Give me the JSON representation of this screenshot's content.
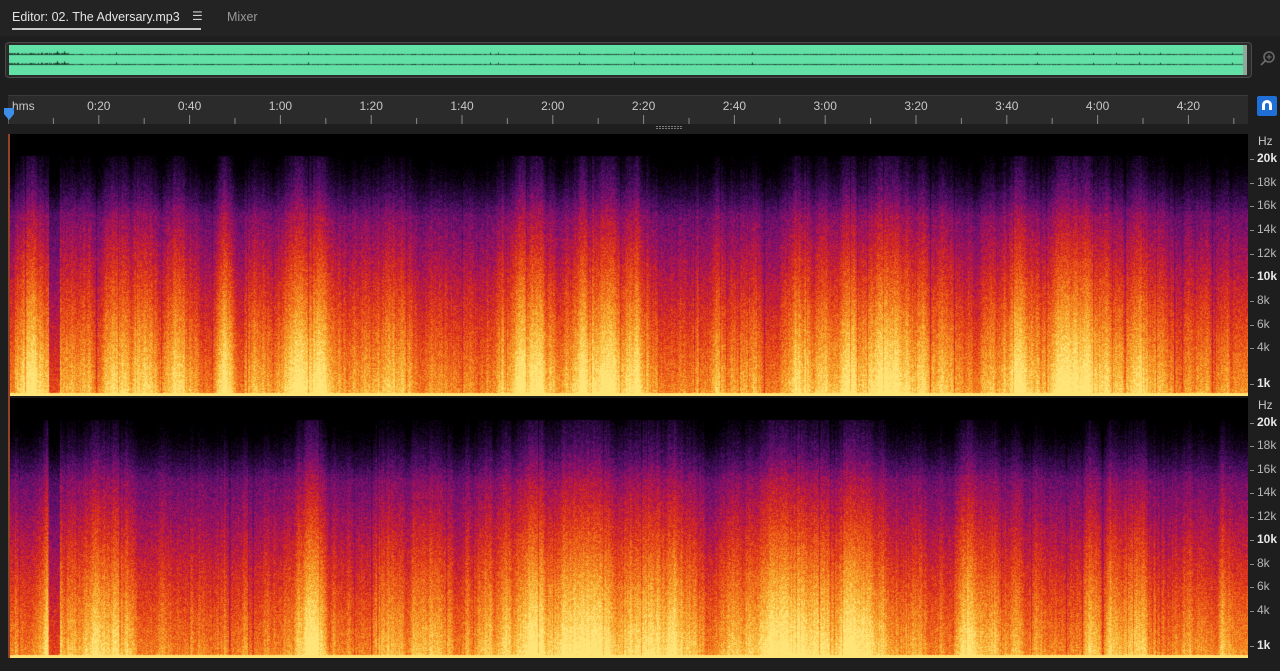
{
  "tabs": {
    "editor_label": "Editor: 02. The Adversary.mp3",
    "menu_icon": "hamburger-icon",
    "mixer_label": "Mixer"
  },
  "overview": {
    "wave_color": "#62e0a6",
    "zoom_icon": "magnifier-zoom-icon"
  },
  "ruler": {
    "unit": "hms",
    "labels": [
      "0:20",
      "0:40",
      "1:00",
      "1:20",
      "1:40",
      "2:00",
      "2:20",
      "2:40",
      "3:00",
      "3:20",
      "3:40",
      "4:00",
      "4:20"
    ],
    "playhead_icon": "playhead-marker-icon",
    "snap_icon": "snap-magnet-icon",
    "snap_color": "#1f6fd6"
  },
  "frequency_scale": {
    "unit": "Hz",
    "labels": [
      "20k",
      "18k",
      "16k",
      "14k",
      "12k",
      "10k",
      "8k",
      "6k",
      "4k",
      "1k"
    ],
    "bold_labels": [
      "20k",
      "10k",
      "1k"
    ]
  },
  "spectrogram": {
    "channels": 2,
    "palette": [
      "#000000",
      "#2a0a3a",
      "#5a1070",
      "#a01060",
      "#d8281a",
      "#f06818",
      "#f8b030",
      "#ffe070"
    ]
  }
}
